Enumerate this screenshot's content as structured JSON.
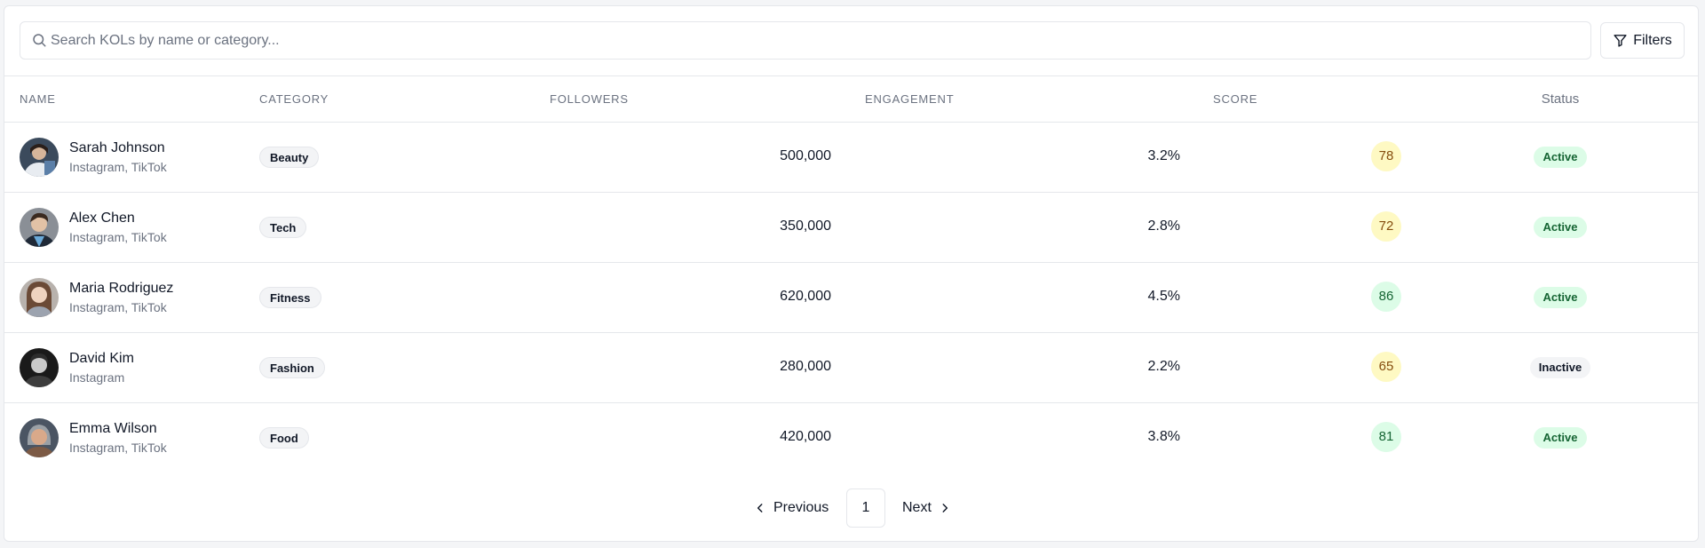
{
  "search": {
    "placeholder": "Search KOLs by name or category..."
  },
  "toolbar": {
    "filters_label": "Filters"
  },
  "table": {
    "headers": {
      "name": "NAME",
      "category": "CATEGORY",
      "followers": "FOLLOWERS",
      "engagement": "ENGAGEMENT",
      "score": "SCORE",
      "status": "Status"
    },
    "rows": [
      {
        "name": "Sarah Johnson",
        "platforms": "Instagram, TikTok",
        "category": "Beauty",
        "followers": "500,000",
        "engagement": "3.2%",
        "score": "78",
        "status": "Active"
      },
      {
        "name": "Alex Chen",
        "platforms": "Instagram, TikTok",
        "category": "Tech",
        "followers": "350,000",
        "engagement": "2.8%",
        "score": "72",
        "status": "Active"
      },
      {
        "name": "Maria Rodriguez",
        "platforms": "Instagram, TikTok",
        "category": "Fitness",
        "followers": "620,000",
        "engagement": "4.5%",
        "score": "86",
        "status": "Active"
      },
      {
        "name": "David Kim",
        "platforms": "Instagram",
        "category": "Fashion",
        "followers": "280,000",
        "engagement": "2.2%",
        "score": "65",
        "status": "Inactive"
      },
      {
        "name": "Emma Wilson",
        "platforms": "Instagram, TikTok",
        "category": "Food",
        "followers": "420,000",
        "engagement": "3.8%",
        "score": "81",
        "status": "Active"
      }
    ]
  },
  "pagination": {
    "previous_label": "Previous",
    "current_page": "1",
    "next_label": "Next"
  },
  "colors": {
    "score_mid_bg": "#fef9c3",
    "score_mid_text": "#854d0e",
    "score_high_bg": "#dcfce7",
    "score_high_text": "#166534",
    "status_active_bg": "#dcfce7",
    "status_active_text": "#166534",
    "status_inactive_bg": "#f3f4f6"
  },
  "icons": {
    "search": "search-icon",
    "filters": "filter-icon",
    "previous": "chevron-left-icon",
    "next": "chevron-right-icon"
  }
}
